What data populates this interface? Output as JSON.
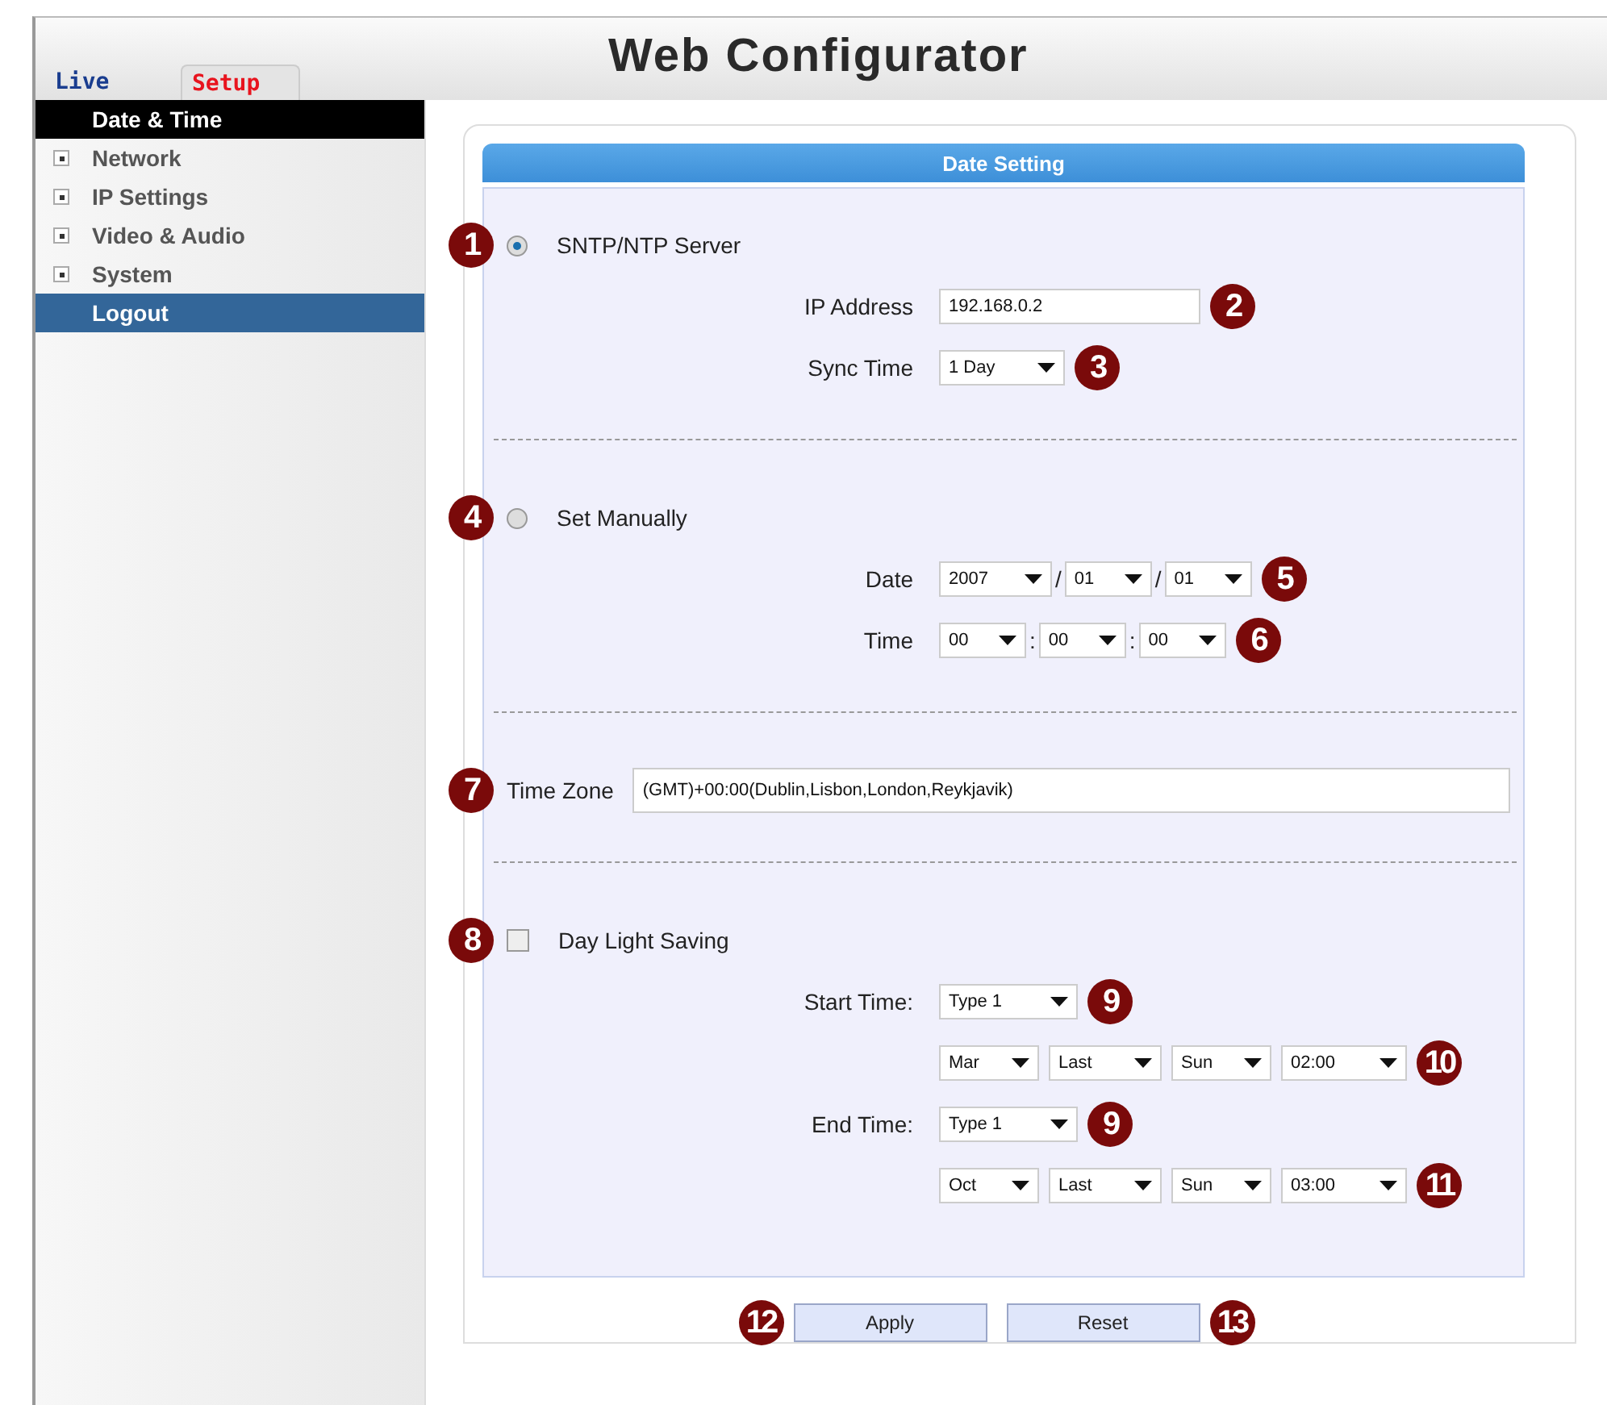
{
  "header": {
    "title": "Web Configurator"
  },
  "tabs": [
    {
      "label": "Live",
      "selected": false
    },
    {
      "label": "Setup",
      "selected": true
    }
  ],
  "sidebar": {
    "items": [
      {
        "label": "Date & Time",
        "kind": "page",
        "selected": true,
        "highlighted": false
      },
      {
        "label": "Network",
        "kind": "group",
        "selected": false,
        "highlighted": false
      },
      {
        "label": "IP Settings",
        "kind": "group",
        "selected": false,
        "highlighted": false
      },
      {
        "label": "Video & Audio",
        "kind": "group",
        "selected": false,
        "highlighted": false
      },
      {
        "label": "System",
        "kind": "group",
        "selected": false,
        "highlighted": false
      },
      {
        "label": "Logout",
        "kind": "action",
        "selected": false,
        "highlighted": true
      }
    ]
  },
  "panel": {
    "title": "Date Setting",
    "sections": [
      {
        "rows": [
          {
            "kind": "radio",
            "callout": "1",
            "label": "SNTP/NTP Server",
            "selected": true
          },
          {
            "kind": "fields",
            "label": "IP Address",
            "callout": "2",
            "items": [
              {
                "kind": "text",
                "value": "192.168.0.2"
              }
            ]
          },
          {
            "kind": "fields",
            "label": "Sync Time",
            "callout": "3",
            "items": [
              {
                "kind": "select",
                "value": "1 Day"
              }
            ]
          }
        ]
      },
      {
        "rows": [
          {
            "kind": "radio",
            "callout": "4",
            "label": "Set Manually",
            "selected": false
          },
          {
            "kind": "fields",
            "label": "Date",
            "callout": "5",
            "items": [
              {
                "kind": "select",
                "value": "2007"
              },
              {
                "kind": "sep",
                "value": "/"
              },
              {
                "kind": "select",
                "value": "01"
              },
              {
                "kind": "sep",
                "value": "/"
              },
              {
                "kind": "select",
                "value": "01"
              }
            ]
          },
          {
            "kind": "fields",
            "label": "Time",
            "callout": "6",
            "items": [
              {
                "kind": "select",
                "value": "00"
              },
              {
                "kind": "sep",
                "value": ":"
              },
              {
                "kind": "select",
                "value": "00"
              },
              {
                "kind": "sep",
                "value": ":"
              },
              {
                "kind": "select",
                "value": "00"
              }
            ]
          }
        ]
      },
      {
        "rows": [
          {
            "kind": "zone",
            "callout": "7",
            "label": "Time Zone",
            "value": "(GMT)+00:00(Dublin,Lisbon,London,Reykjavik)"
          }
        ]
      },
      {
        "rows": [
          {
            "kind": "checkbox",
            "callout": "8",
            "label": "Day Light Saving",
            "checked": false
          },
          {
            "kind": "fields",
            "label": "Start Time:",
            "callout": "9",
            "items": [
              {
                "kind": "select",
                "value": "Type 1"
              }
            ]
          },
          {
            "kind": "fields",
            "callout": "10",
            "items": [
              {
                "kind": "select",
                "value": "Mar"
              },
              {
                "kind": "select",
                "value": "Last"
              },
              {
                "kind": "select",
                "value": "Sun"
              },
              {
                "kind": "select",
                "value": "02:00"
              }
            ]
          },
          {
            "kind": "fields",
            "label": "End Time:",
            "callout": "9",
            "items": [
              {
                "kind": "select",
                "value": "Type 1"
              }
            ]
          },
          {
            "kind": "fields",
            "callout": "11",
            "items": [
              {
                "kind": "select",
                "value": "Oct"
              },
              {
                "kind": "select",
                "value": "Last"
              },
              {
                "kind": "select",
                "value": "Sun"
              },
              {
                "kind": "select",
                "value": "03:00"
              }
            ]
          }
        ]
      }
    ]
  },
  "buttons": [
    {
      "label": "Apply",
      "callout": "12"
    },
    {
      "label": "Reset",
      "callout": "13"
    }
  ]
}
